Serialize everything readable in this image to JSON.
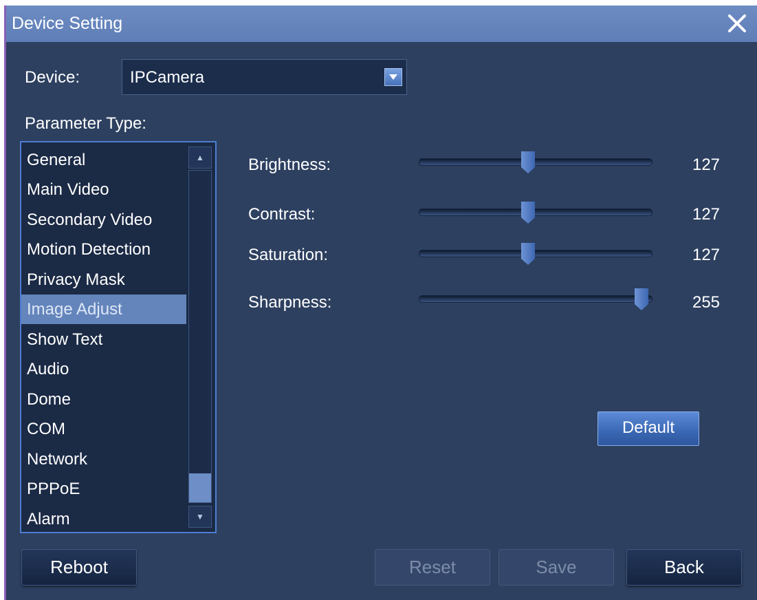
{
  "window": {
    "title": "Device Setting",
    "close_icon": "close-icon"
  },
  "device": {
    "label": "Device:",
    "value": "IPCamera"
  },
  "param_type": {
    "label": "Parameter Type:",
    "items": [
      "General",
      "Main Video",
      "Secondary Video",
      "Motion Detection",
      "Privacy Mask",
      "Image Adjust",
      "Show Text",
      "Audio",
      "Dome",
      "COM",
      "Network",
      "PPPoE",
      "Alarm"
    ],
    "selected": "Image Adjust"
  },
  "sliders": [
    {
      "label": "Brightness:",
      "value": 127,
      "max": 255
    },
    {
      "label": "Contrast:",
      "value": 127,
      "max": 255
    },
    {
      "label": "Saturation:",
      "value": 127,
      "max": 255
    },
    {
      "label": "Sharpness:",
      "value": 255,
      "max": 255
    }
  ],
  "buttons": {
    "default": "Default",
    "reboot": "Reboot",
    "reset": "Reset",
    "save": "Save",
    "back": "Back"
  },
  "colors": {
    "background": "#2d4060",
    "titlebar": "#6483bb",
    "selected_item": "#6485bc",
    "accent": "#4e7ed2"
  }
}
